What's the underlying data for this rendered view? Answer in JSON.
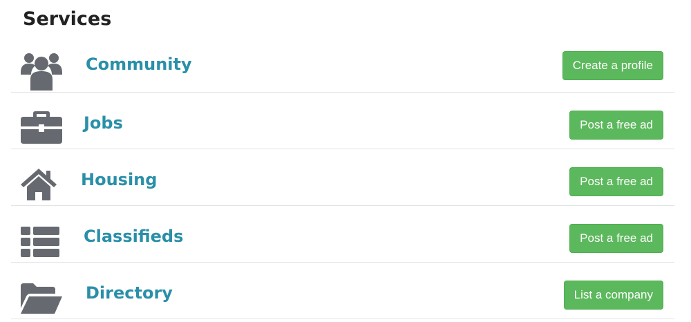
{
  "section": {
    "title": "Services"
  },
  "services": [
    {
      "icon": "users-icon",
      "label": "Community",
      "button": "Create a profile"
    },
    {
      "icon": "briefcase-icon",
      "label": "Jobs",
      "button": "Post a free ad"
    },
    {
      "icon": "home-icon",
      "label": "Housing",
      "button": "Post a free ad"
    },
    {
      "icon": "list-icon",
      "label": "Classifieds",
      "button": "Post a free ad"
    },
    {
      "icon": "folder-open-icon",
      "label": "Directory",
      "button": "List a company"
    }
  ],
  "colors": {
    "link": "#2a8fa8",
    "button_bg": "#5cb85c",
    "icon": "#666a70",
    "divider": "#e2e2e2"
  }
}
